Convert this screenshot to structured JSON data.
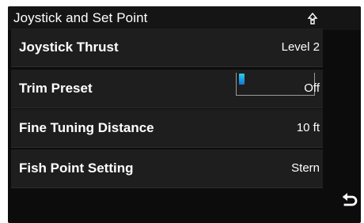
{
  "header": {
    "title": "Joystick and Set Point",
    "status_icon": "pin-icon"
  },
  "rows": [
    {
      "label": "Joystick Thrust",
      "value": "Level 2"
    },
    {
      "label": "Trim Preset",
      "value": "Off"
    },
    {
      "label": "Fine Tuning Distance",
      "value": "10 ft"
    },
    {
      "label": "Fish Point Setting",
      "value": "Stern"
    }
  ],
  "colors": {
    "background": "#0c0c0c",
    "row": "#1e1e1e",
    "text": "#ffffff",
    "toggle_accent": "#2ad0e8"
  },
  "icons": {
    "back": "back-arrow-icon"
  }
}
